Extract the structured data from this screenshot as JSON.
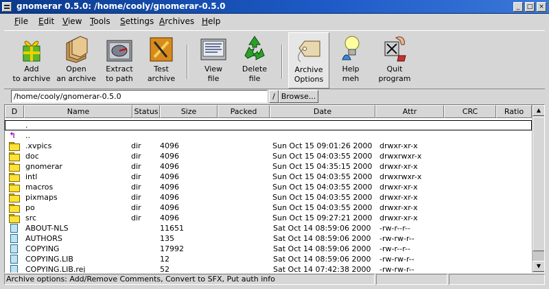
{
  "window": {
    "title": "gnomerar 0.5.0: /home/cooly/gnomerar-0.5.0",
    "minimize_glyph": "_",
    "maximize_glyph": "□",
    "close_glyph": "×"
  },
  "menu": [
    "File",
    "Edit",
    "View",
    "Tools",
    "Settings",
    "Archives",
    "Help"
  ],
  "toolbar": [
    {
      "line1": "Add",
      "line2": "to archive",
      "icon": "gift-icon"
    },
    {
      "line1": "Open",
      "line2": "an archive",
      "icon": "folder-stack-icon"
    },
    {
      "line1": "Extract",
      "line2": "to path",
      "icon": "extract-disk-icon"
    },
    {
      "line1": "Test",
      "line2": "archive",
      "icon": "tools-test-icon"
    },
    {
      "line1": "View",
      "line2": "file",
      "icon": "monitor-view-icon"
    },
    {
      "line1": "Delete",
      "line2": "file",
      "icon": "recycle-icon"
    },
    {
      "line1": "Archive",
      "line2": "Options",
      "icon": "tag-icon"
    },
    {
      "line1": "Help",
      "line2": "meh",
      "icon": "lightbulb-icon"
    },
    {
      "line1": "Quit",
      "line2": "program",
      "icon": "quit-icon"
    }
  ],
  "path": {
    "value": "/home/cooly/gnomerar-0.5.0",
    "slash": "/",
    "browse_label": "Browse..."
  },
  "columns": [
    "D",
    "Name",
    "Status",
    "Size",
    "Packed",
    "Date",
    "Attr",
    "CRC",
    "Ratio"
  ],
  "rows": [
    {
      "type": "current",
      "name": ".",
      "status": "",
      "size": "",
      "date": "",
      "attr": ""
    },
    {
      "type": "up",
      "name": "..",
      "status": "",
      "size": "",
      "date": "",
      "attr": ""
    },
    {
      "type": "dir",
      "name": ".xvpics",
      "status": "dir",
      "size": "4096",
      "date": "Sun Oct 15 09:01:26 2000",
      "attr": "drwxr-xr-x"
    },
    {
      "type": "dir",
      "name": "doc",
      "status": "dir",
      "size": "4096",
      "date": "Sun Oct 15 04:03:55 2000",
      "attr": "drwxrwxr-x"
    },
    {
      "type": "dir",
      "name": "gnomerar",
      "status": "dir",
      "size": "4096",
      "date": "Sun Oct 15 04:35:15 2000",
      "attr": "drwxr-xr-x"
    },
    {
      "type": "dir",
      "name": "intl",
      "status": "dir",
      "size": "4096",
      "date": "Sun Oct 15 04:03:55 2000",
      "attr": "drwxrwxr-x"
    },
    {
      "type": "dir",
      "name": "macros",
      "status": "dir",
      "size": "4096",
      "date": "Sun Oct 15 04:03:55 2000",
      "attr": "drwxr-xr-x"
    },
    {
      "type": "dir",
      "name": "pixmaps",
      "status": "dir",
      "size": "4096",
      "date": "Sun Oct 15 04:03:55 2000",
      "attr": "drwxr-xr-x"
    },
    {
      "type": "dir",
      "name": "po",
      "status": "dir",
      "size": "4096",
      "date": "Sun Oct 15 04:03:55 2000",
      "attr": "drwxr-xr-x"
    },
    {
      "type": "dir",
      "name": "src",
      "status": "dir",
      "size": "4096",
      "date": "Sun Oct 15 09:27:21 2000",
      "attr": "drwxr-xr-x"
    },
    {
      "type": "file",
      "name": "ABOUT-NLS",
      "status": "",
      "size": "11651",
      "date": "Sat Oct 14 08:59:06 2000",
      "attr": "-rw-r--r--"
    },
    {
      "type": "file",
      "name": "AUTHORS",
      "status": "",
      "size": "135",
      "date": "Sat Oct 14 08:59:06 2000",
      "attr": "-rw-rw-r--"
    },
    {
      "type": "file",
      "name": "COPYING",
      "status": "",
      "size": "17992",
      "date": "Sat Oct 14 08:59:06 2000",
      "attr": "-rw-r--r--"
    },
    {
      "type": "file",
      "name": "COPYING.LIB",
      "status": "",
      "size": "12",
      "date": "Sat Oct 14 08:59:06 2000",
      "attr": "-rw-rw-r--"
    },
    {
      "type": "file",
      "name": "COPYING.LIB.rej",
      "status": "",
      "size": "52",
      "date": "Sat Oct 14 07:42:38 2000",
      "attr": "-rw-rw-r--"
    }
  ],
  "status": {
    "message": "Archive options: Add/Remove Comments, Convert to SFX, Put auth info"
  }
}
